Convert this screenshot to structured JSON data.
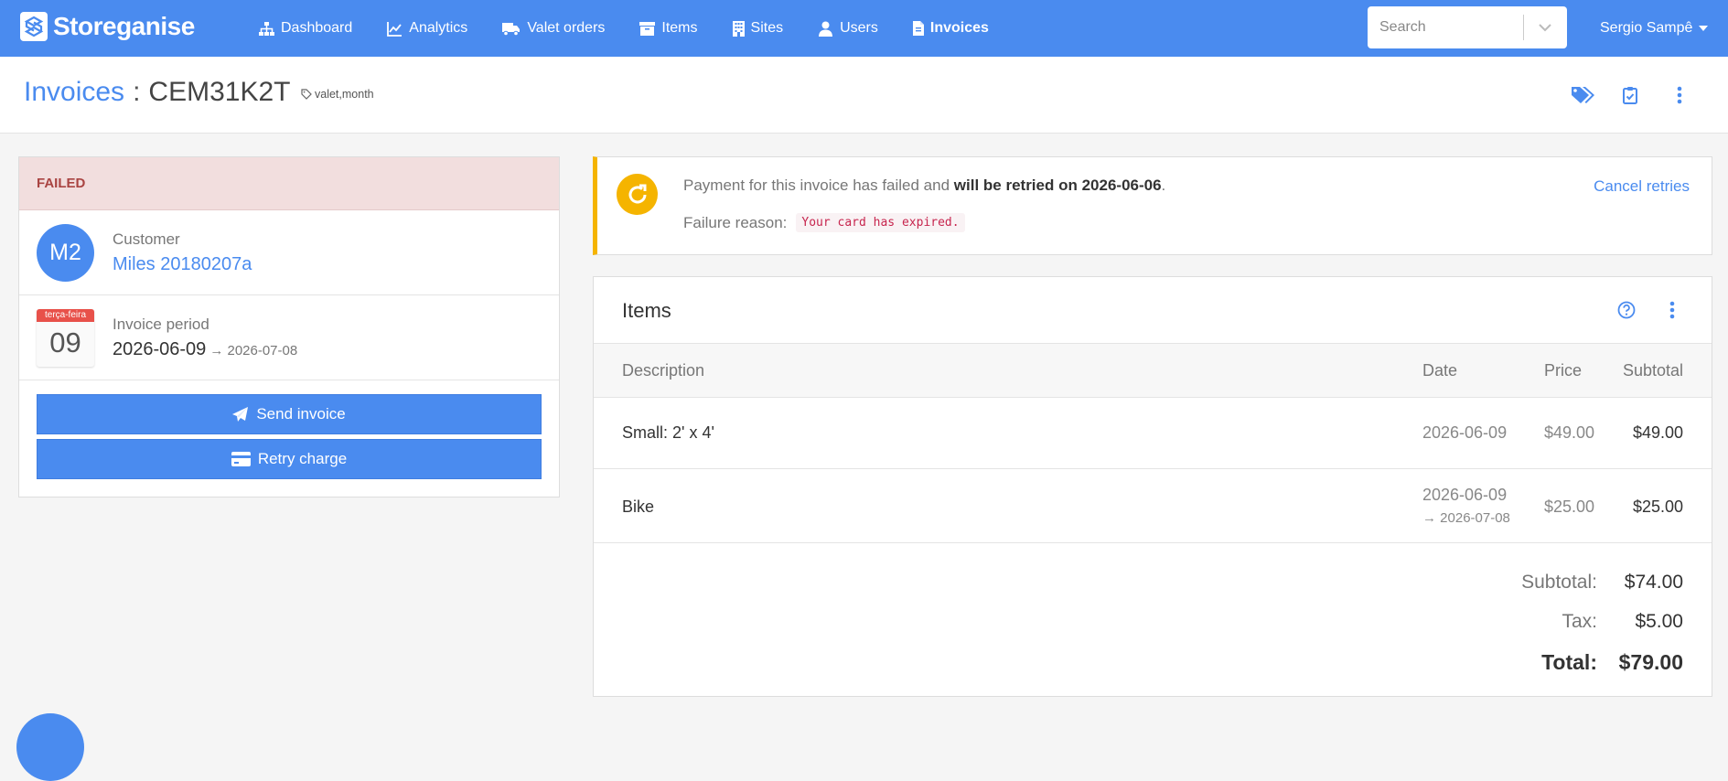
{
  "brand": {
    "name": "Storeganise"
  },
  "nav": {
    "items": [
      {
        "label": "Dashboard",
        "icon": "sitemap-icon"
      },
      {
        "label": "Analytics",
        "icon": "line-chart-icon"
      },
      {
        "label": "Valet orders",
        "icon": "truck-icon"
      },
      {
        "label": "Items",
        "icon": "archive-icon"
      },
      {
        "label": "Sites",
        "icon": "building-icon"
      },
      {
        "label": "Users",
        "icon": "user-icon"
      },
      {
        "label": "Invoices",
        "icon": "file-invoice-icon",
        "active": true
      }
    ],
    "search_placeholder": "Search",
    "user_name": "Sergio Sampê"
  },
  "header": {
    "breadcrumb": "Invoices",
    "separator": ":",
    "invoice_id": "CEM31K2T",
    "tags": "valet,month"
  },
  "invoice": {
    "status": "FAILED",
    "customer_label": "Customer",
    "customer_initials": "M2",
    "customer_name": "Miles 20180207a",
    "period_label": "Invoice period",
    "calendar_weekday": "terça-feira",
    "calendar_day": "09",
    "period_start": "2026-06-09",
    "period_end": "→ 2026-07-08",
    "send_label": "Send invoice",
    "retry_label": "Retry charge"
  },
  "alert": {
    "message_prefix": "Payment for this invoice has failed and ",
    "message_bold": "will be retried on 2026-06-06",
    "message_suffix": ".",
    "reason_label": "Failure reason:",
    "reason_code": "Your card has expired.",
    "cancel_label": "Cancel retries"
  },
  "items": {
    "title": "Items",
    "columns": {
      "description": "Description",
      "date": "Date",
      "price": "Price",
      "subtotal": "Subtotal"
    },
    "rows": [
      {
        "description": "Small: 2' x 4'",
        "date": "2026-06-09",
        "date_end": "",
        "price": "$49.00",
        "subtotal": "$49.00"
      },
      {
        "description": "Bike",
        "date": "2026-06-09",
        "date_end": "→ 2026-07-08",
        "price": "$25.00",
        "subtotal": "$25.00"
      }
    ],
    "subtotal_label": "Subtotal:",
    "subtotal_value": "$74.00",
    "tax_label": "Tax:",
    "tax_value": "$5.00",
    "total_label": "Total:",
    "total_value": "$79.00"
  },
  "colors": {
    "primary": "#4a8bef",
    "failed_bg": "#f2dede",
    "failed_text": "#a94442",
    "warning": "#f5b400",
    "calendar_red": "#e8514a"
  }
}
